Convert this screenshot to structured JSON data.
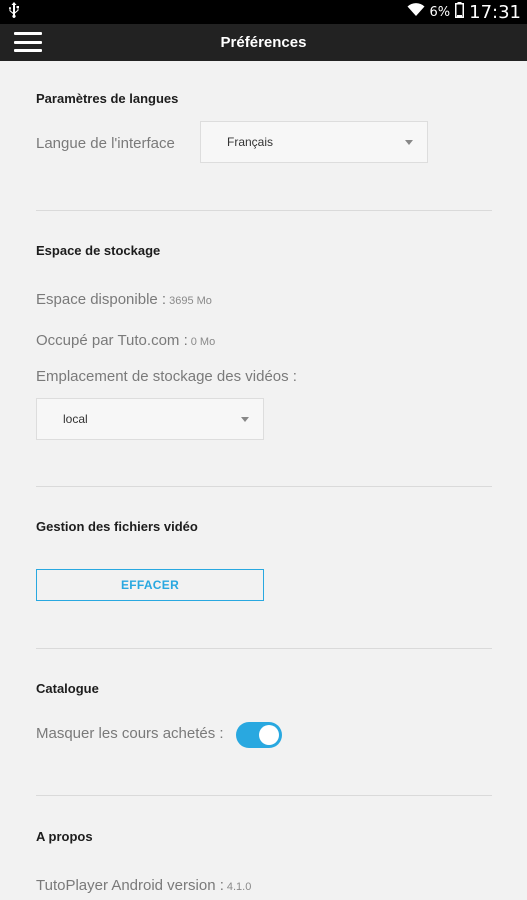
{
  "status_bar": {
    "usb_icon": "usb-icon",
    "wifi_icon": "wifi-icon",
    "battery_percent": "6%",
    "battery_icon": "battery-icon",
    "time": "17:31"
  },
  "app_bar": {
    "menu_icon": "hamburger-menu-icon",
    "title": "Préférences"
  },
  "language": {
    "section_title": "Paramètres de langues",
    "interface_label": "Langue de l'interface",
    "interface_value": "Français"
  },
  "storage": {
    "section_title": "Espace de stockage",
    "available_label": "Espace disponible :",
    "available_value": "3695 Mo",
    "used_label": "Occupé par Tuto.com :",
    "used_value": "0 Mo",
    "location_label": "Emplacement de stockage des vidéos :",
    "location_value": "local"
  },
  "video_files": {
    "section_title": "Gestion des fichiers vidéo",
    "clear_button": "EFFACER"
  },
  "catalogue": {
    "section_title": "Catalogue",
    "hide_purchased_label": "Masquer les cours achetés :",
    "hide_purchased_enabled": true
  },
  "about": {
    "section_title": "A propos",
    "version_label": "TutoPlayer Android version :",
    "version_value": "4.1.0"
  },
  "colors": {
    "accent": "#29a8e0",
    "app_bar": "#222222",
    "background": "#f2f2f2"
  }
}
